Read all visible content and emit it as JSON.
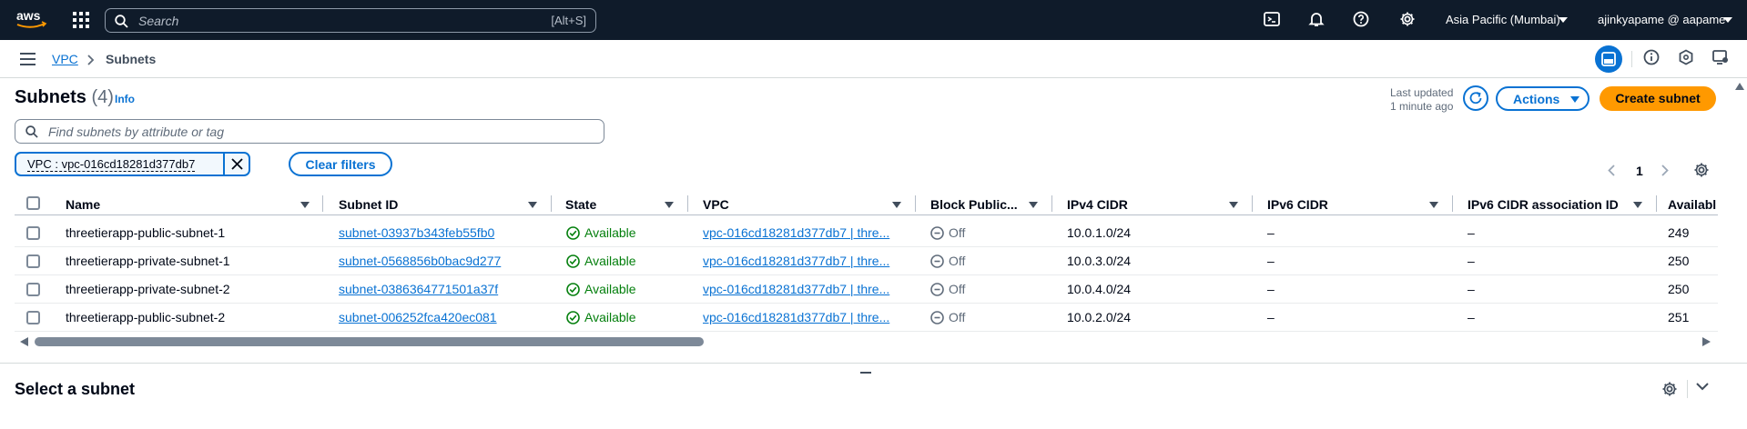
{
  "topnav": {
    "logo": "aws",
    "search_placeholder": "Search",
    "search_shortcut": "[Alt+S]",
    "icons": [
      "cloudshell-icon",
      "bell-icon",
      "help-icon",
      "gear-icon"
    ],
    "region": "Asia Pacific (Mumbai)",
    "account": "ajinkyapame @ aapame"
  },
  "breadcrumb": {
    "parent": "VPC",
    "current": "Subnets"
  },
  "header": {
    "title": "Subnets",
    "count": "(4)",
    "info": "Info",
    "last_updated_label": "Last updated",
    "last_updated_value": "1 minute ago",
    "actions_label": "Actions",
    "create_label": "Create subnet"
  },
  "filter": {
    "placeholder": "Find subnets by attribute or tag",
    "token": "VPC : vpc-016cd18281d377db7",
    "clear_label": "Clear filters"
  },
  "pagination": {
    "page": "1"
  },
  "table": {
    "columns": [
      "Name",
      "Subnet ID",
      "State",
      "VPC",
      "Block Public...",
      "IPv4 CIDR",
      "IPv6 CIDR",
      "IPv6 CIDR association ID",
      "Availabl"
    ],
    "rows": [
      {
        "name": "threetierapp-public-subnet-1",
        "subnet_id": "subnet-03937b343feb55fb0",
        "state": "Available",
        "vpc": "vpc-016cd18281d377db7 | thre...",
        "block": "Off",
        "ipv4": "10.0.1.0/24",
        "ipv6": "–",
        "ipv6_assoc": "–",
        "available": "249"
      },
      {
        "name": "threetierapp-private-subnet-1",
        "subnet_id": "subnet-0568856b0bac9d277",
        "state": "Available",
        "vpc": "vpc-016cd18281d377db7 | thre...",
        "block": "Off",
        "ipv4": "10.0.3.0/24",
        "ipv6": "–",
        "ipv6_assoc": "–",
        "available": "250"
      },
      {
        "name": "threetierapp-private-subnet-2",
        "subnet_id": "subnet-0386364771501a37f",
        "state": "Available",
        "vpc": "vpc-016cd18281d377db7 | thre...",
        "block": "Off",
        "ipv4": "10.0.4.0/24",
        "ipv6": "–",
        "ipv6_assoc": "–",
        "available": "250"
      },
      {
        "name": "threetierapp-public-subnet-2",
        "subnet_id": "subnet-006252fca420ec081",
        "state": "Available",
        "vpc": "vpc-016cd18281d377db7 | thre...",
        "block": "Off",
        "ipv4": "10.0.2.0/24",
        "ipv6": "–",
        "ipv6_assoc": "–",
        "available": "251"
      }
    ]
  },
  "detail_panel": {
    "title": "Select a subnet"
  },
  "colors": {
    "nav_bg": "#0f1b2a",
    "link": "#0972d3",
    "primary_button": "#ff9900",
    "success": "#037f0c"
  }
}
